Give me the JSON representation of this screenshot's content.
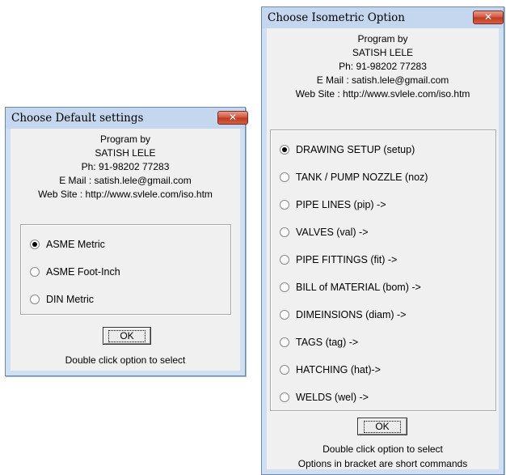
{
  "credits": {
    "line1": "Program by",
    "line2": "SATISH LELE",
    "phone": "Ph: 91-98202 77283",
    "email": "E Mail : satish.lele@gmail.com",
    "website": "Web Site : http://www.svlele.com/iso.htm"
  },
  "default_dialog": {
    "title": "Choose Default settings",
    "close_glyph": "✕",
    "options": [
      {
        "label": "ASME Metric",
        "selected": true
      },
      {
        "label": "ASME Foot-Inch",
        "selected": false
      },
      {
        "label": "DIN Metric",
        "selected": false
      }
    ],
    "ok_label": "OK",
    "hint": "Double click option to select"
  },
  "iso_dialog": {
    "title": "Choose Isometric Option",
    "close_glyph": "✕",
    "options": [
      {
        "label": "DRAWING SETUP (setup)",
        "selected": true
      },
      {
        "label": "TANK / PUMP NOZZLE (noz)",
        "selected": false
      },
      {
        "label": "PIPE LINES (pip) ->",
        "selected": false
      },
      {
        "label": "VALVES (val) ->",
        "selected": false
      },
      {
        "label": "PIPE FITTINGS (fit) ->",
        "selected": false
      },
      {
        "label": "BILL of MATERIAL (bom) ->",
        "selected": false
      },
      {
        "label": "DIMEINSIONS (diam) ->",
        "selected": false
      },
      {
        "label": "TAGS (tag) ->",
        "selected": false
      },
      {
        "label": "HATCHING (hat)->",
        "selected": false
      },
      {
        "label": "WELDS (wel) ->",
        "selected": false
      }
    ],
    "ok_label": "OK",
    "hint": "Double click option to select",
    "hint2": "Options in bracket are short commands"
  }
}
